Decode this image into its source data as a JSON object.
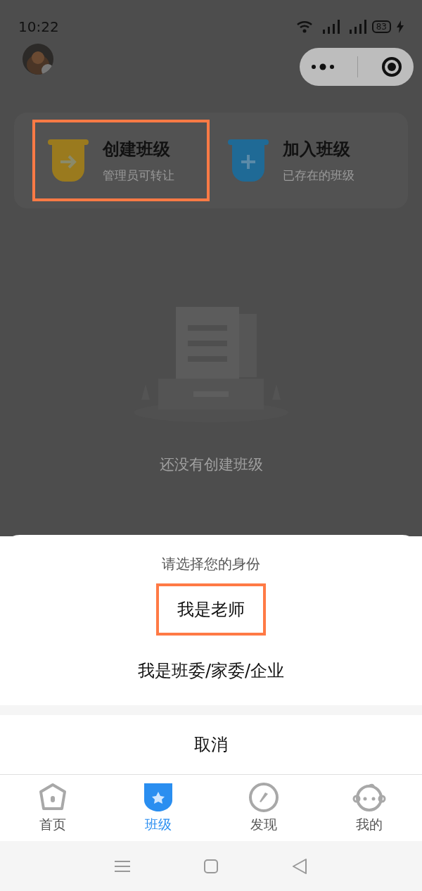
{
  "status_bar": {
    "time": "10:22",
    "battery": "83"
  },
  "actions": [
    {
      "kind": "create",
      "title": "创建班级",
      "subtitle": "管理员可转让",
      "highlighted": true
    },
    {
      "kind": "join",
      "title": "加入班级",
      "subtitle": "已存在的班级",
      "highlighted": false
    }
  ],
  "empty_state": {
    "text": "还没有创建班级"
  },
  "sheet": {
    "title": "请选择您的身份",
    "options": [
      {
        "label": "我是老师",
        "highlighted": true
      },
      {
        "label": "我是班委/家委/企业",
        "highlighted": false
      }
    ],
    "cancel": "取消"
  },
  "tabs": [
    {
      "kind": "home",
      "label": "首页",
      "selected": false
    },
    {
      "kind": "class",
      "label": "班级",
      "selected": true
    },
    {
      "kind": "discover",
      "label": "发现",
      "selected": false
    },
    {
      "kind": "me",
      "label": "我的",
      "selected": false
    }
  ]
}
